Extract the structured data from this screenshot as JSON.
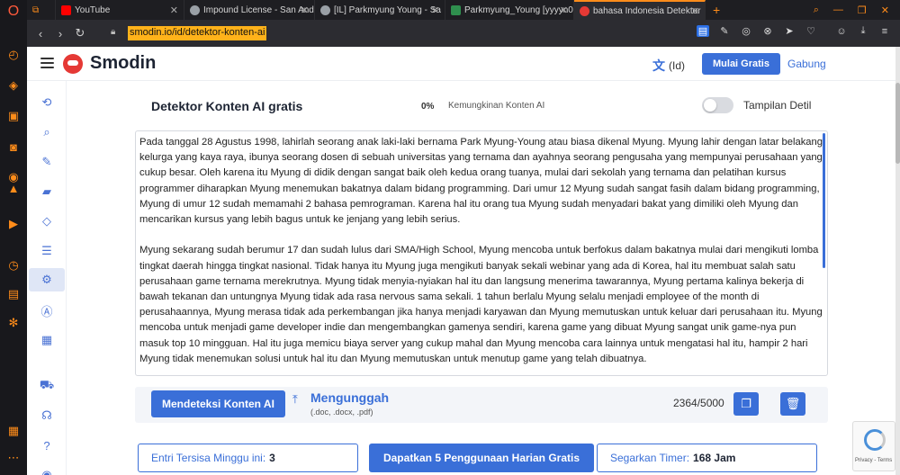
{
  "browser": {
    "tabs": [
      {
        "label": "YouTube",
        "color": "#ff0000"
      },
      {
        "label": "Impound License - San And",
        "color": "#9aa0a6"
      },
      {
        "label": "[IL] Parkmyung Young - Sa",
        "color": "#9aa0a6"
      },
      {
        "label": "Parkmyung_Young [yyyyn0",
        "color": "#2f8f4e"
      },
      {
        "label": "bahasa Indonesia Detektor",
        "color": "#e53935"
      }
    ],
    "url": "smodin.io/id/detektor-konten-ai"
  },
  "header": {
    "brand": "Smodin",
    "lang": "(Id)",
    "start_free": "Mulai Gratis",
    "join": "Gabung"
  },
  "main": {
    "title": "Detektor Konten AI gratis",
    "percent": "0%",
    "probability_label": "Kemungkinan Konten AI",
    "detail_label": "Tampilan Detil",
    "paragraphs": [
      "Pada tanggal 28 Agustus 1998, lahirlah seorang anak laki-laki bernama Park Myung-Young atau biasa dikenal Myung. Myung lahir dengan latar belakang kelurga yang kaya raya, ibunya seorang dosen di sebuah universitas yang ternama dan ayahnya seorang pengusaha yang mempunyai perusahaan yang cukup besar. Oleh karena itu Myung di didik dengan sangat baik oleh kedua orang tuanya, mulai dari sekolah yang ternama dan pelatihan kursus programmer diharapkan Myung menemukan bakatnya dalam bidang programming. Dari umur 12 Myung sudah sangat fasih dalam bidang programming, Myung di umur 12 sudah memamahi 2 bahasa pemrograman. Karena hal itu orang tua Myung sudah menyadari bakat yang dimiliki oleh Myung dan mencarikan kursus yang lebih bagus untuk ke jenjang yang lebih serius.",
      "Myung sekarang sudah berumur 17 dan sudah lulus dari SMA/High School, Myung mencoba untuk berfokus dalam bakatnya mulai dari mengikuti lomba tingkat daerah hingga tingkat nasional. Tidak hanya itu Myung juga mengikuti banyak sekali webinar yang ada di Korea, hal itu membuat salah satu perusahaan game ternama merekrutnya. Myung tidak menyia-nyiakan hal itu dan langsung menerima tawarannya, Myung pertama kalinya bekerja di bawah tekanan dan untungnya Myung tidak ada rasa nervous sama sekali. 1 tahun berlalu Myung selalu menjadi employee of the month di perusahaannya, Myung merasa tidak ada perkembangan jika hanya menjadi karyawan dan Myung memutuskan untuk keluar dari perusahaan itu. Myung mencoba untuk menjadi game developer indie dan mengembangkan gamenya sendiri, karena game yang dibuat Myung sangat unik game-nya pun masuk top 10 mingguan. Hal itu juga memicu biaya server yang cukup mahal dan Myung mencoba cara lainnya untuk mengatasi hal itu, hampir 2 hari Myung tidak menemukan solusi untuk hal itu dan Myung memutuskan untuk menutup game yang telah dibuatnya."
    ],
    "detect_button": "Mendeteksi Konten AI",
    "upload_label": "Mengunggah",
    "upload_formats": "(.doc, .docx, .pdf)",
    "char_count": "2364/5000"
  },
  "footer": {
    "entries_label": "Entri Tersisa Minggu ini:",
    "entries_value": "3",
    "cta": "Dapatkan 5 Penggunaan Harian Gratis",
    "timer_label": "Segarkan Timer:",
    "timer_value": "168 Jam"
  },
  "recaptcha": {
    "text": "Privacy - Terms"
  },
  "colors": {
    "accent": "#3a6fd8",
    "brand_red": "#e53935",
    "opera_orange": "#ff8c1a"
  }
}
